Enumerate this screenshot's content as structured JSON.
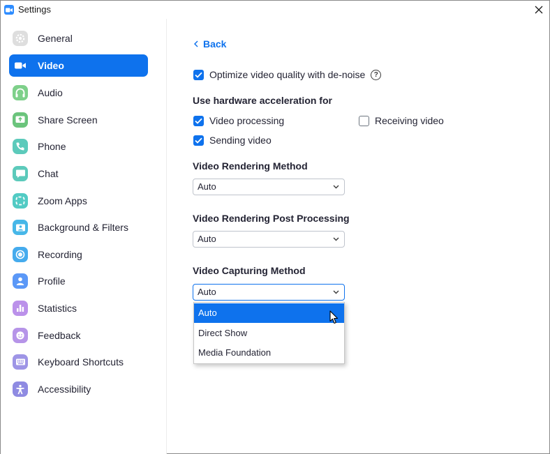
{
  "window": {
    "title": "Settings"
  },
  "sidebar": {
    "items": [
      {
        "label": "General",
        "icon": "gear-icon",
        "color": "#d9d9d9",
        "active": false
      },
      {
        "label": "Video",
        "icon": "video-camera-icon",
        "color": "#0e72ed",
        "active": true
      },
      {
        "label": "Audio",
        "icon": "headphones-icon",
        "color": "#6bcb77",
        "active": false
      },
      {
        "label": "Share Screen",
        "icon": "share-screen-icon",
        "color": "#5fbf6f",
        "active": false
      },
      {
        "label": "Phone",
        "icon": "phone-icon",
        "color": "#4ec5b5",
        "active": false
      },
      {
        "label": "Chat",
        "icon": "chat-icon",
        "color": "#4ec5b5",
        "active": false
      },
      {
        "label": "Zoom Apps",
        "icon": "apps-icon",
        "color": "#48c7c0",
        "active": false
      },
      {
        "label": "Background & Filters",
        "icon": "background-icon",
        "color": "#3ab2e6",
        "active": false
      },
      {
        "label": "Recording",
        "icon": "record-icon",
        "color": "#3aa9ec",
        "active": false
      },
      {
        "label": "Profile",
        "icon": "profile-icon",
        "color": "#4f8ef7",
        "active": false
      },
      {
        "label": "Statistics",
        "icon": "statistics-icon",
        "color": "#b689e8",
        "active": false
      },
      {
        "label": "Feedback",
        "icon": "feedback-icon",
        "color": "#b08be6",
        "active": false
      },
      {
        "label": "Keyboard Shortcuts",
        "icon": "keyboard-icon",
        "color": "#9a8fe4",
        "active": false
      },
      {
        "label": "Accessibility",
        "icon": "accessibility-icon",
        "color": "#8a86e0",
        "active": false
      }
    ]
  },
  "main": {
    "back_label": "Back",
    "denoise": {
      "label": "Optimize video quality with de-noise",
      "checked": true,
      "help_glyph": "?"
    },
    "hw_heading": "Use hardware acceleration for",
    "hw": {
      "video_processing": {
        "label": "Video processing",
        "checked": true
      },
      "receiving_video": {
        "label": "Receiving video",
        "checked": false
      },
      "sending_video": {
        "label": "Sending video",
        "checked": true
      }
    },
    "rendering_method": {
      "label": "Video Rendering Method",
      "value": "Auto"
    },
    "post_processing": {
      "label": "Video Rendering Post Processing",
      "value": "Auto"
    },
    "capturing_method": {
      "label": "Video Capturing Method",
      "value": "Auto",
      "options": [
        "Auto",
        "Direct Show",
        "Media Foundation"
      ],
      "highlighted": "Auto"
    }
  },
  "colors": {
    "accent": "#0e72ed",
    "text": "#232333",
    "window_border": "#8a8a8a"
  }
}
